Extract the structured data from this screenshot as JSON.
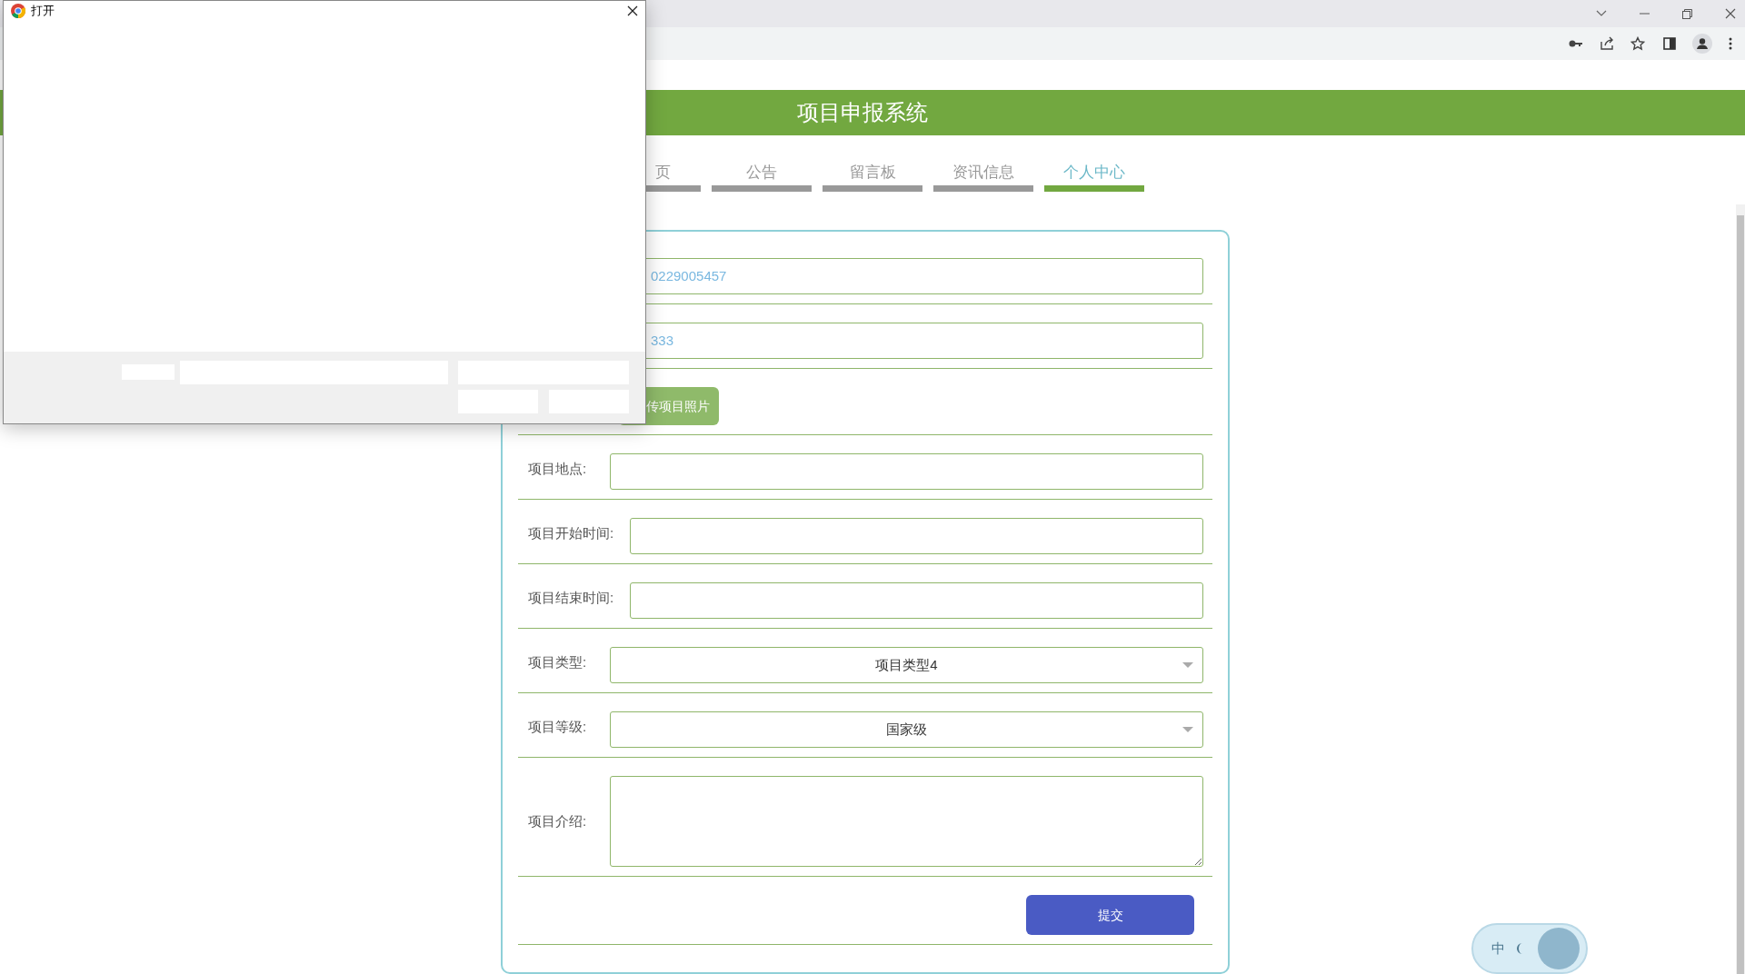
{
  "dialog": {
    "title": "打开"
  },
  "site": {
    "title": "项目申报系统"
  },
  "nav": [
    {
      "label": "页",
      "selected": false
    },
    {
      "label": "公告",
      "selected": false
    },
    {
      "label": "留言板",
      "selected": false
    },
    {
      "label": "资讯信息",
      "selected": false
    },
    {
      "label": "个人中心",
      "selected": true
    }
  ],
  "form": [
    {
      "kind": "input",
      "value": "0229005457"
    },
    {
      "kind": "input",
      "value": "333"
    },
    {
      "kind": "upload",
      "button": "传项目照片"
    },
    {
      "kind": "input",
      "label": "项目地点:"
    },
    {
      "kind": "input",
      "label": "项目开始时间:"
    },
    {
      "kind": "input",
      "label": "项目结束时间:"
    },
    {
      "kind": "select",
      "label": "项目类型:",
      "value": "项目类型4"
    },
    {
      "kind": "select",
      "label": "项目等级:",
      "value": "国家级"
    },
    {
      "kind": "textarea",
      "label": "项目介绍:"
    },
    {
      "kind": "submit",
      "button": "提交"
    }
  ],
  "ime": {
    "label": "中"
  }
}
